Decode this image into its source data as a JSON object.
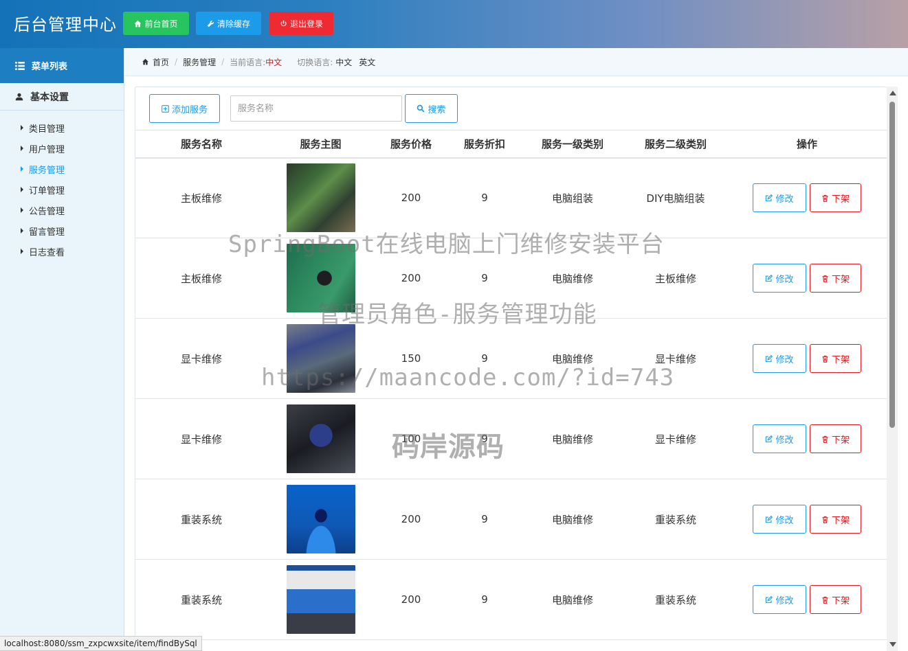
{
  "header": {
    "title": "后台管理中心",
    "buttons": [
      {
        "label": "前台首页",
        "icon": "home-icon",
        "color": "#27c45f"
      },
      {
        "label": "清除缓存",
        "icon": "wrench-icon",
        "color": "#1c9be8"
      },
      {
        "label": "退出登录",
        "icon": "power-icon",
        "color": "#ee2a33"
      }
    ]
  },
  "sidebar": {
    "menu_title": "菜单列表",
    "section_title": "基本设置",
    "items": [
      {
        "label": "类目管理"
      },
      {
        "label": "用户管理"
      },
      {
        "label": "服务管理",
        "active": true
      },
      {
        "label": "订单管理"
      },
      {
        "label": "公告管理"
      },
      {
        "label": "留言管理"
      },
      {
        "label": "日志查看"
      }
    ]
  },
  "breadcrumb": {
    "home": "首页",
    "current": "服务管理",
    "current_lang_label": "当前语言:",
    "current_lang_value": "中文",
    "switch_lang_label": "切换语言:",
    "lang_zh": "中文",
    "lang_en": "英文"
  },
  "toolbar": {
    "add_label": "添加服务",
    "search_placeholder": "服务名称",
    "search_value": "",
    "search_label": "搜索"
  },
  "table": {
    "columns": [
      "服务名称",
      "服务主图",
      "服务价格",
      "服务折扣",
      "服务一级类别",
      "服务二级类别",
      "操作"
    ],
    "edit_label": "修改",
    "delete_label": "下架",
    "rows": [
      {
        "name": "主板维修",
        "image": "motherboard-photo",
        "price": "200",
        "discount": "9",
        "cat1": "电脑组装",
        "cat2": "DIY电脑组装"
      },
      {
        "name": "主板维修",
        "image": "motherboard-repair-photo",
        "price": "200",
        "discount": "9",
        "cat1": "电脑维修",
        "cat2": "主板维修"
      },
      {
        "name": "显卡维修",
        "image": "graphics-card-photo",
        "price": "150",
        "discount": "9",
        "cat1": "电脑维修",
        "cat2": "显卡维修"
      },
      {
        "name": "显卡维修",
        "image": "graphics-card-closeup-photo",
        "price": "100",
        "discount": "9",
        "cat1": "电脑维修",
        "cat2": "显卡维修"
      },
      {
        "name": "重装系统",
        "image": "windows-setup-photo",
        "price": "200",
        "discount": "9",
        "cat1": "电脑维修",
        "cat2": "重装系统"
      },
      {
        "name": "重装系统",
        "image": "windows-installer-photo",
        "price": "200",
        "discount": "9",
        "cat1": "电脑维修",
        "cat2": "重装系统"
      }
    ]
  },
  "watermark": {
    "line1": "SpringBoot在线电脑上门维修安装平台",
    "line2": "管理员角色-服务管理功能",
    "line3": "https://maancode.com/?id=743",
    "line4": "码岸源码"
  },
  "status_bar": "localhost:8080/ssm_zxpcwxsite/item/findBySql",
  "colors": {
    "primary": "#1c9be8",
    "danger": "#e4151c",
    "success": "#27c45f",
    "sidebar_bg": "#eaf4fb",
    "menu_head_bg": "#1d7fc2"
  }
}
